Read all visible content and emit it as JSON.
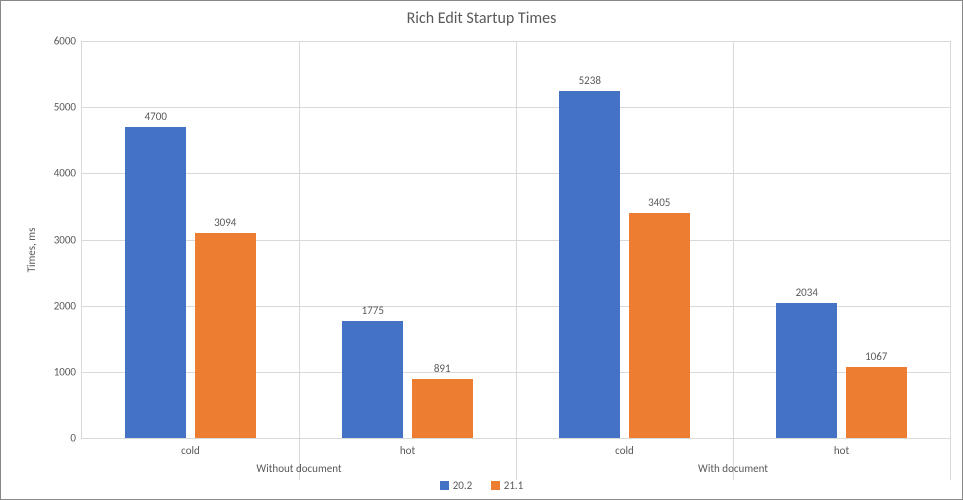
{
  "chart_data": {
    "type": "bar",
    "title": "Rich Edit Startup Times",
    "ylabel": "Times, ms",
    "xlabel": "",
    "ylim": [
      0,
      6000
    ],
    "ytick_step": 1000,
    "groups": [
      "Without document",
      "With document"
    ],
    "categories": [
      "cold",
      "hot",
      "cold",
      "hot"
    ],
    "category_group_index": [
      0,
      0,
      1,
      1
    ],
    "series": [
      {
        "name": "20.2",
        "color": "#4472c4",
        "values": [
          4700,
          1775,
          5238,
          2034
        ]
      },
      {
        "name": "21.1",
        "color": "#ed7d31",
        "values": [
          3094,
          891,
          3405,
          1067
        ]
      }
    ],
    "legend_position": "bottom"
  }
}
